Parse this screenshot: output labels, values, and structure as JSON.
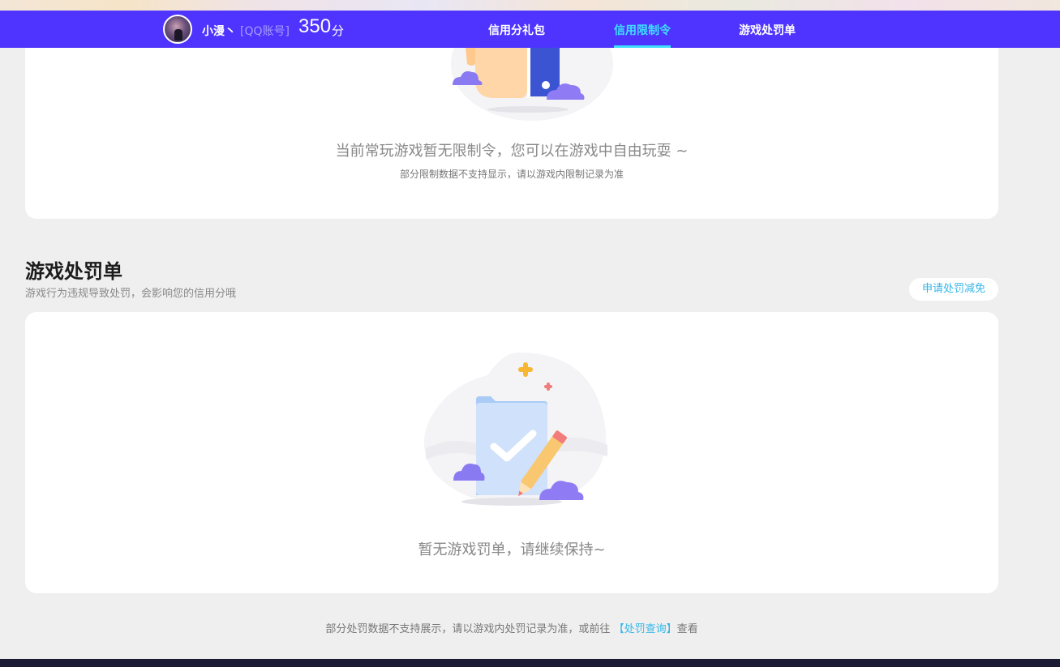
{
  "header": {
    "nickname": "小漫丶",
    "account_type": "[QQ账号]",
    "score": "350",
    "score_unit": "分",
    "nav": [
      {
        "label": "信用分礼包",
        "active": false
      },
      {
        "label": "信用限制令",
        "active": true
      },
      {
        "label": "游戏处罚单",
        "active": false
      }
    ]
  },
  "restriction": {
    "empty_title": "当前常玩游戏暂无限制令，您可以在游戏中自由玩耍 ~",
    "empty_note": "部分限制数据不支持显示，请以游戏内限制记录为准"
  },
  "penalty": {
    "title": "游戏处罚单",
    "description": "游戏行为违规导致处罚，会影响您的信用分哦",
    "appeal_button": "申请处罚减免",
    "empty_title": "暂无游戏罚单，请继续保持~"
  },
  "footer": {
    "note_prefix": "部分处罚数据不支持展示，请以游戏内处罚记录为准，或前往",
    "link_label": "【处罚查询】",
    "note_suffix": "查看"
  },
  "colors": {
    "header_bg": "#4e34fe",
    "nav_active": "#3fe0ff",
    "link": "#36b7e8",
    "page_bg": "#efefef"
  }
}
